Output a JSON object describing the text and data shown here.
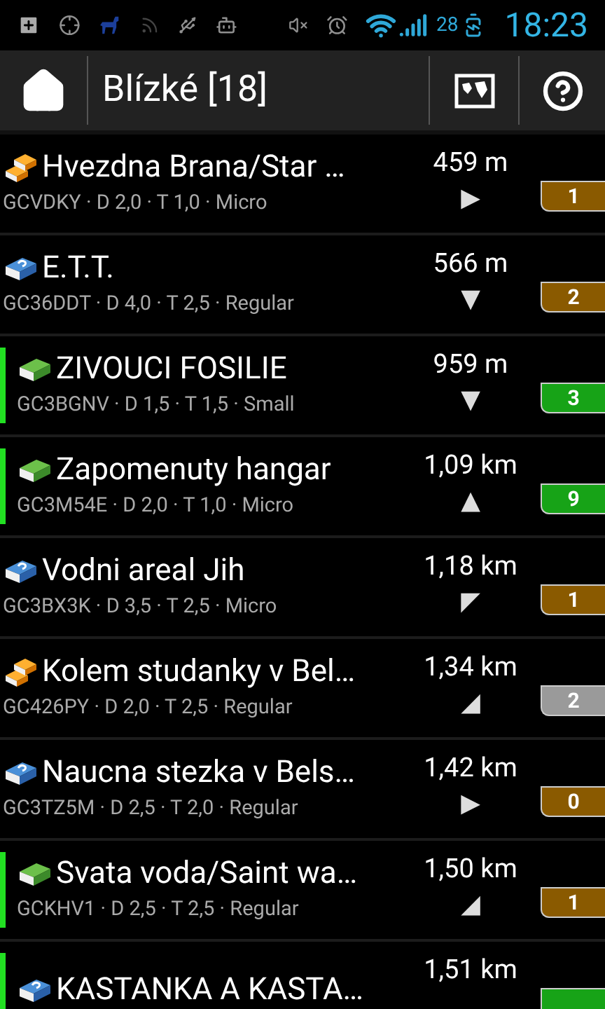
{
  "status_bar": {
    "battery": "28",
    "time": "18:23"
  },
  "header": {
    "title": "Blízké [18]"
  },
  "caches": [
    {
      "kind": "multi",
      "marked": false,
      "name": "Hvezdna Brana/Star …",
      "details": "GCVDKY · D 2,0 · T 1,0 · Micro",
      "distance": "459 m",
      "heading": "▶",
      "count": "1",
      "color": "#8a5a00"
    },
    {
      "kind": "mystery",
      "marked": false,
      "name": "E.T.T.",
      "details": "GC36DDT · D 4,0 · T 2,5 · Regular",
      "distance": "566 m",
      "heading": "▼",
      "count": "2",
      "color": "#8a5a00"
    },
    {
      "kind": "traditional",
      "marked": true,
      "name": "ZIVOUCI FOSILIE",
      "details": "GC3BGNV · D 1,5 · T 1,5 · Small",
      "distance": "959 m",
      "heading": "▼",
      "count": "3",
      "color": "#17a317"
    },
    {
      "kind": "traditional",
      "marked": true,
      "name": "Zapomenuty hangar",
      "details": "GC3M54E · D 2,0 · T 1,0 · Micro",
      "distance": "1,09 km",
      "heading": "▲",
      "count": "9",
      "color": "#17a317"
    },
    {
      "kind": "mystery",
      "marked": false,
      "name": "Vodni areal Jih",
      "details": "GC3BX3K · D 3,5 · T 2,5 · Micro",
      "distance": "1,18 km",
      "heading": "◤",
      "count": "1",
      "color": "#8a5a00"
    },
    {
      "kind": "multi",
      "marked": false,
      "name": "Kolem studanky v Bel…",
      "details": "GC426PY · D 2,0 · T 2,5 · Regular",
      "distance": "1,34 km",
      "heading": "◢",
      "count": "2",
      "color": "#9a9a9a"
    },
    {
      "kind": "mystery",
      "marked": false,
      "name": "Naucna stezka v Bels…",
      "details": "GC3TZ5M · D 2,5 · T 2,0 · Regular",
      "distance": "1,42 km",
      "heading": "▶",
      "count": "0",
      "color": "#8a5a00"
    },
    {
      "kind": "traditional",
      "marked": true,
      "name": "Svata voda/Saint wa…",
      "details": "GCKHV1 · D 2,5 · T 2,5 · Regular",
      "distance": "1,50 km",
      "heading": "◢",
      "count": "1",
      "color": "#8a5a00"
    },
    {
      "kind": "mystery",
      "marked": true,
      "name": "KASTANKA A KASTA…",
      "distance": "1,51 km",
      "color": "#17a317"
    }
  ]
}
